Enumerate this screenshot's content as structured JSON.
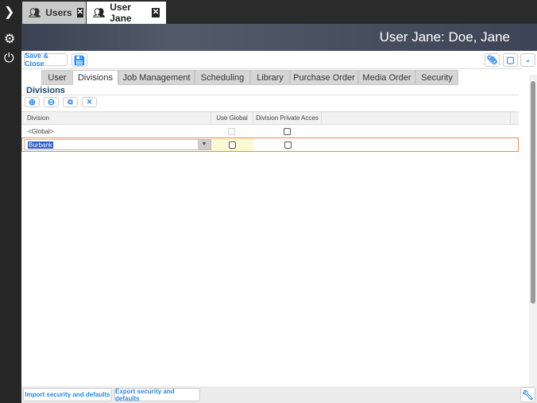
{
  "sidebar": {
    "icons": [
      "chevron-right-icon",
      "gear-icon",
      "power-icon"
    ]
  },
  "window_tabs": [
    {
      "label": "Users",
      "active": false
    },
    {
      "label": "User Jane",
      "active": true
    }
  ],
  "header": {
    "title": "User Jane: Doe, Jane"
  },
  "toolbar": {
    "save_close": "Save & Close",
    "attachments_count": "0",
    "comments_count": "0"
  },
  "tabs": [
    "User",
    "Divisions",
    "Job Management",
    "Scheduling",
    "Library",
    "Purchase Order",
    "Media Order",
    "Security"
  ],
  "active_tab": "Divisions",
  "divisions": {
    "title": "Divisions",
    "columns": [
      "Division",
      "Use Global",
      "Division Private Acces"
    ],
    "rows": [
      {
        "division": "<Global>",
        "use_global": false,
        "use_global_disabled": true,
        "private": false
      },
      {
        "division": "Burbank",
        "use_global": false,
        "private": false,
        "editing": true
      }
    ]
  },
  "footer": {
    "import": "Import security and defaults",
    "export": "Export security and defaults"
  },
  "colors": {
    "accent": "#2a8ae6",
    "selection_border": "#f08a4b"
  }
}
